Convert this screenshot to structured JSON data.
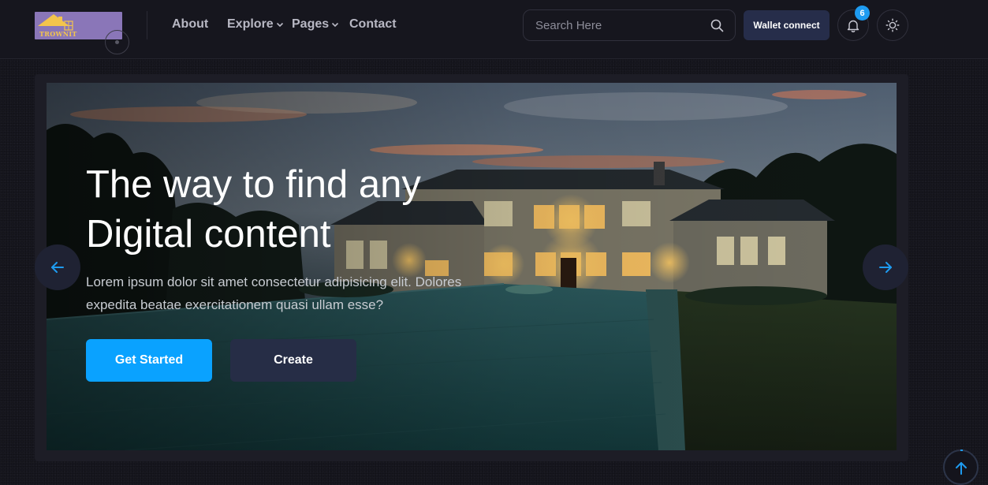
{
  "header": {
    "logo_text": "TROWNIT",
    "nav": [
      {
        "label": "About",
        "has_dropdown": false
      },
      {
        "label": "Explore",
        "has_dropdown": true
      },
      {
        "label": "Pages",
        "has_dropdown": true
      },
      {
        "label": "Contact",
        "has_dropdown": false
      }
    ],
    "search": {
      "placeholder": "Search Here",
      "value": ""
    },
    "wallet_label": "Wallet connect",
    "notification_count": "6",
    "icons": {
      "search": "search-icon",
      "bell": "bell-icon",
      "theme": "sun-icon",
      "dropdown": "chevron-down-icon"
    }
  },
  "hero": {
    "title_line1": "The way to find any",
    "title_line2": "Digital content",
    "description": "Lorem ipsum dolor sit amet consectetur adipisicing elit. Dolores expedita beatae exercitationem quasi ullam esse?",
    "primary_button": "Get Started",
    "secondary_button": "Create",
    "icons": {
      "prev": "arrow-left-icon",
      "next": "arrow-right-icon"
    }
  },
  "scroll_top": {
    "icon": "arrow-up-icon"
  },
  "colors": {
    "accent": "#0aa2ff",
    "badge": "#1e9bf0",
    "background": "#17171f",
    "wallet_button": "#262d4a"
  }
}
